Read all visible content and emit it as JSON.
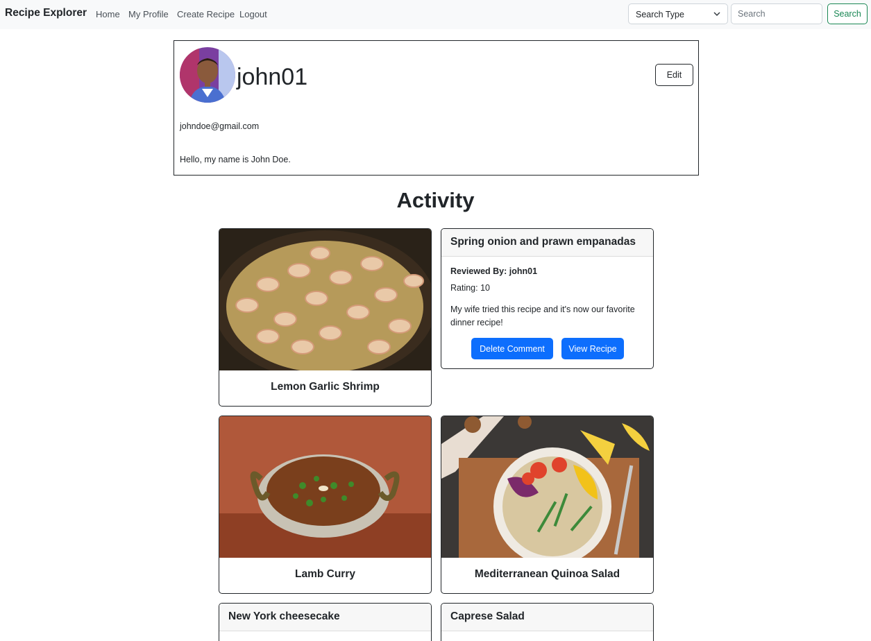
{
  "navbar": {
    "brand": "Recipe Explorer",
    "links": [
      "Home",
      "My Profile",
      "Create Recipe",
      "Logout"
    ],
    "search_type": "Search Type",
    "search_placeholder": "Search",
    "search_button": "Search"
  },
  "profile": {
    "username": "john01",
    "edit_label": "Edit",
    "email": "johndoe@gmail.com",
    "bio": "Hello, my name is John Doe."
  },
  "activity": {
    "title": "Activity",
    "recipe_cards": [
      {
        "title": "Lemon Garlic Shrimp"
      },
      {
        "title": "Lamb Curry"
      },
      {
        "title": "Mediterranean Quinoa Salad"
      }
    ],
    "review": {
      "recipe": "Spring onion and prawn empanadas",
      "reviewed_by_label": "Reviewed By: john01",
      "rating_label": "Rating: 10",
      "comment": "My wife tried this recipe and it's now our favorite dinner recipe!",
      "delete_label": "Delete Comment",
      "view_label": "View Recipe"
    },
    "partial_cards": [
      {
        "title": "New York cheesecake"
      },
      {
        "title": "Caprese Salad"
      }
    ]
  },
  "colors": {
    "primary": "#0d6efd",
    "success": "#198754",
    "navbar_bg": "#f8f9fa"
  },
  "icons": {
    "select_chevron": "chevron-down-icon"
  }
}
